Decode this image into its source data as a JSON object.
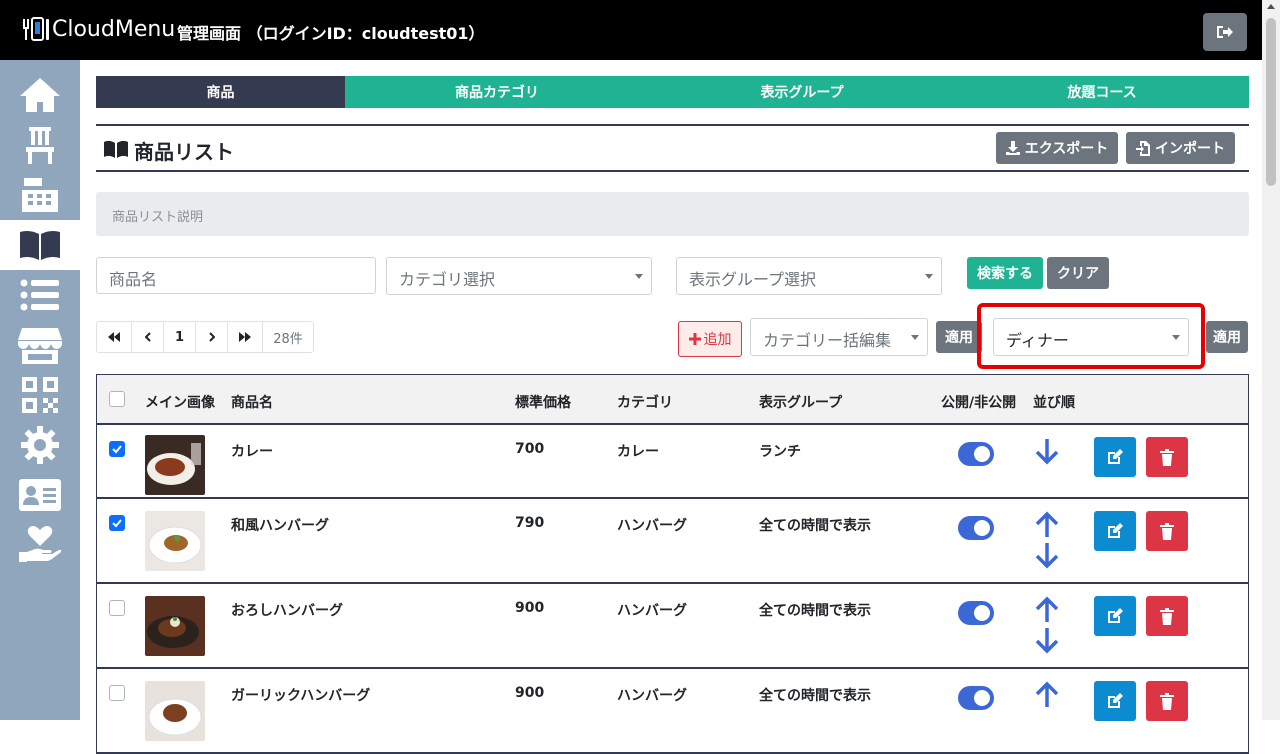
{
  "header": {
    "logo_text": "CloudMenu",
    "admin_label": "管理画面 （ログインID：cloudtest01）"
  },
  "sidebar": {
    "items": [
      {
        "icon": "home-icon"
      },
      {
        "icon": "chair-icon"
      },
      {
        "icon": "register-icon"
      },
      {
        "icon": "book-icon",
        "active": true
      },
      {
        "icon": "list-icon"
      },
      {
        "icon": "store-icon"
      },
      {
        "icon": "qrcode-icon"
      },
      {
        "icon": "gear-icon"
      },
      {
        "icon": "id-card-icon"
      },
      {
        "icon": "hand-heart-icon"
      }
    ]
  },
  "tabs": [
    {
      "label": "商品",
      "active": true
    },
    {
      "label": "商品カテゴリ"
    },
    {
      "label": "表示グループ"
    },
    {
      "label": "放題コース"
    }
  ],
  "section": {
    "title": "商品リスト",
    "export_label": "エクスポート",
    "import_label": "インポート",
    "description": "商品リスト説明"
  },
  "search": {
    "name_placeholder": "商品名",
    "category_placeholder": "カテゴリ選択",
    "group_placeholder": "表示グループ選択",
    "search_label": "検索する",
    "clear_label": "クリア"
  },
  "pager": {
    "page": "1",
    "count": "28件"
  },
  "bulk": {
    "add_label": "追加",
    "category_bulk_placeholder": "カテゴリー括編集",
    "apply_label": "適用",
    "group_value": "ディナー",
    "apply2_label": "適用"
  },
  "table": {
    "headers": {
      "image": "メイン画像",
      "name": "商品名",
      "price": "標準価格",
      "category": "カテゴリ",
      "group": "表示グループ",
      "publish": "公開/非公開",
      "order": "並び順"
    },
    "rows": [
      {
        "checked": true,
        "name": "カレー",
        "price": "700",
        "category": "カレー",
        "group": "ランチ",
        "published": true
      },
      {
        "checked": true,
        "name": "和風ハンバーグ",
        "price": "790",
        "category": "ハンバーグ",
        "group": "全ての時間で表示",
        "published": true
      },
      {
        "checked": false,
        "name": "おろしハンバーグ",
        "price": "900",
        "category": "ハンバーグ",
        "group": "全ての時間で表示",
        "published": true
      },
      {
        "checked": false,
        "name": "ガーリックハンバーグ",
        "price": "900",
        "category": "ハンバーグ",
        "group": "全ての時間で表示",
        "published": true
      }
    ]
  },
  "colors": {
    "tab_active": "#343a50",
    "tab": "#1fb393",
    "sidebar": "#8fa6bd",
    "highlight": "#e60000",
    "toggle_on": "#3b68d6"
  }
}
